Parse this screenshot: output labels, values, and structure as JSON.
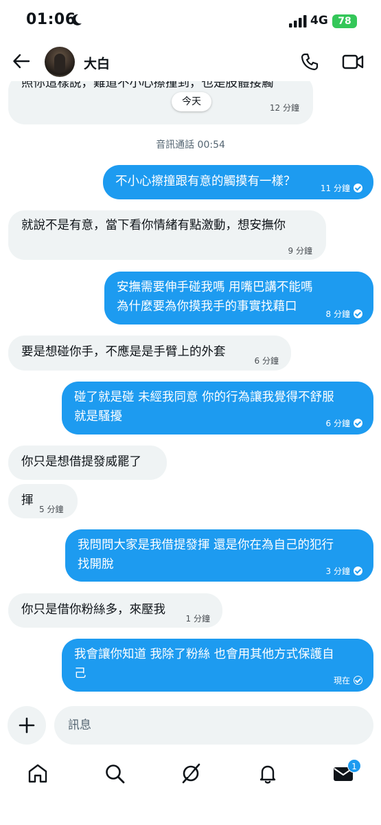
{
  "status_bar": {
    "time": "01:06",
    "network": "4G",
    "battery": "78"
  },
  "header": {
    "contact_name": "大白"
  },
  "chat": {
    "date_divider": "今天",
    "call_note": "音訊通話 00:54",
    "messages": [
      {
        "side": "in",
        "lines": [
          "照你這樣說，難道不小心擦撞到，也是肢體接觸"
        ],
        "time": "12 分鐘"
      },
      {
        "side": "out",
        "lines": [
          "不小心擦撞跟有意的觸摸有一樣？"
        ],
        "time": "11 分鐘"
      },
      {
        "side": "in",
        "lines": [
          "就說不是有意，當下看你情緒有點激動，想安撫你"
        ],
        "time": "9 分鐘"
      },
      {
        "side": "out",
        "lines": [
          "安撫需要伸手碰我嗎 用嘴巴講不能嗎",
          "為什麼要為你摸我手的事實找藉口"
        ],
        "time": "8 分鐘"
      },
      {
        "side": "in",
        "lines": [
          "要是想碰你手，不應是是手臂上的外套"
        ],
        "time": "6 分鐘"
      },
      {
        "side": "out",
        "lines": [
          "碰了就是碰 未經我同意 你的行為讓我覺得不舒服",
          "就是騷擾"
        ],
        "time": "6 分鐘"
      },
      {
        "side": "in",
        "lines": [
          "你只是想借提發威罷了"
        ],
        "time": ""
      },
      {
        "side": "in",
        "lines": [
          "揮"
        ],
        "time": "5 分鐘"
      },
      {
        "side": "out",
        "lines": [
          "我問問大家是我借提發揮 還是你在為自己的犯行",
          "找開脫"
        ],
        "time": "3 分鐘"
      },
      {
        "side": "in",
        "lines": [
          "你只是借你粉絲多，來壓我"
        ],
        "time": "1 分鐘"
      },
      {
        "side": "out",
        "lines": [
          "我會讓你知道 我除了粉絲 也會用其他方式保護自",
          "己"
        ],
        "time": "現在"
      }
    ]
  },
  "composer": {
    "placeholder": "訊息"
  },
  "nav": {
    "messages_badge": "1"
  },
  "colors": {
    "accent": "#1d9bf0",
    "incoming_bubble": "#eff3f4",
    "battery": "#34c759"
  }
}
